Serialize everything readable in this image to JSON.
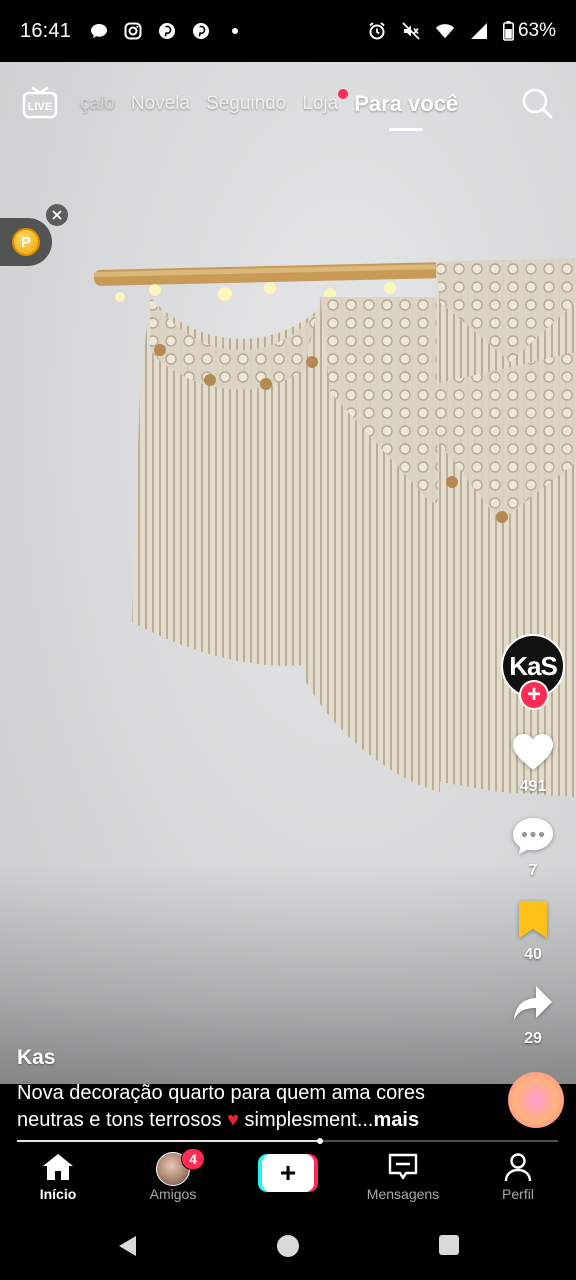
{
  "status_bar": {
    "time": "16:41",
    "left_icons": [
      "chat-bubble-icon",
      "instagram-icon",
      "pinterest-icon",
      "pinterest-icon",
      "dot"
    ],
    "battery": "63%",
    "right_icons": [
      "alarm-icon",
      "mute-icon",
      "wifi-icon",
      "signal-icon",
      "battery-icon"
    ]
  },
  "top_nav": {
    "live_label": "LIVE",
    "tabs": [
      {
        "label": "çalo"
      },
      {
        "label": "Novela"
      },
      {
        "label": "Seguindo"
      },
      {
        "label": "Loja"
      },
      {
        "label": "Para você"
      }
    ],
    "active_tab": "Para você"
  },
  "coin_widget": {
    "coin_symbol": "P"
  },
  "creator": {
    "avatar_text": "KaS",
    "name": "Kas"
  },
  "actions": {
    "likes": "491",
    "comments": "7",
    "saves": "40",
    "shares": "29"
  },
  "caption": {
    "text": "Nova decoração quarto para quem ama cores neutras e tons terrosos",
    "emoji": "♥",
    "tail": " simplesment...",
    "more": "mais"
  },
  "progress": {
    "fraction": 0.56
  },
  "bottom_nav": {
    "items": [
      {
        "label": "Início"
      },
      {
        "label": "Amigos",
        "badge": "4"
      },
      {
        "label": ""
      },
      {
        "label": "Mensagens"
      },
      {
        "label": "Perfil"
      }
    ]
  },
  "colors": {
    "accent": "#fe2c55",
    "cyan": "#25f4ee",
    "save_yellow": "#ffc21a"
  }
}
